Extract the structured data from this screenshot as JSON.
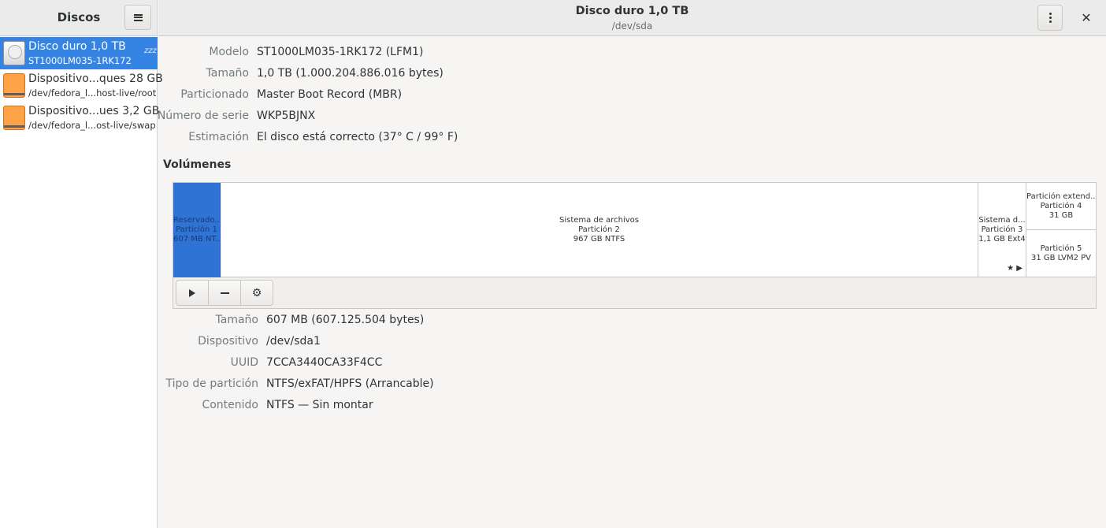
{
  "sidebar": {
    "title": "Discos",
    "disks": [
      {
        "name": "Disco duro 1,0 TB",
        "sub": "ST1000LM035-1RK172",
        "icon": "harddisk-icon",
        "selected": true
      },
      {
        "name": "Dispositivo...ques 28 GB",
        "sub": "/dev/fedora_l...host-live/root",
        "icon": "usb-drive-icon",
        "selected": false
      },
      {
        "name": "Dispositivo...ues 3,2 GB",
        "sub": "/dev/fedora_l...ost-live/swap",
        "icon": "usb-drive-icon",
        "selected": false
      }
    ],
    "sleep_glyph": "zzz"
  },
  "header": {
    "title": "Disco duro 1,0 TB",
    "subtitle": "/dev/sda"
  },
  "drive_info": [
    {
      "label": "Modelo",
      "value": "ST1000LM035-1RK172 (LFM1)"
    },
    {
      "label": "Tamaño",
      "value": "1,0 TB (1.000.204.886.016 bytes)"
    },
    {
      "label": "Particionado",
      "value": "Master Boot Record (MBR)"
    },
    {
      "label": "Número de serie",
      "value": "WKP5BJNX"
    },
    {
      "label": "Estimación",
      "value": "El disco está correcto (37° C / 99° F)"
    }
  ],
  "volumes": {
    "heading": "Volúmenes",
    "partitions": [
      {
        "line1": "Reservado...",
        "line2": "Partición 1",
        "line3": "607 MB NT..."
      },
      {
        "line1": "Sistema de archivos",
        "line2": "Partición 2",
        "line3": "967 GB NTFS"
      },
      {
        "line1": "Sistema d...",
        "line2": "Partición 3",
        "line3": "1,1 GB Ext4"
      },
      {
        "line1": "Partición extend...",
        "line2": "Partición 4",
        "line3": "31 GB"
      },
      {
        "line1": "Partición 5",
        "line2": "31 GB LVM2 PV"
      }
    ]
  },
  "partition_info": [
    {
      "label": "Tamaño",
      "value": "607 MB (607.125.504 bytes)"
    },
    {
      "label": "Dispositivo",
      "value": "/dev/sda1"
    },
    {
      "label": "UUID",
      "value": "7CCA3440CA33F4CC"
    },
    {
      "label": "Tipo de partición",
      "value": "NTFS/exFAT/HPFS (Arrancable)"
    },
    {
      "label": "Contenido",
      "value": "NTFS — Sin montar"
    }
  ],
  "colors": {
    "accent": "#3584e4",
    "selected_volume": "#2f73d5"
  }
}
